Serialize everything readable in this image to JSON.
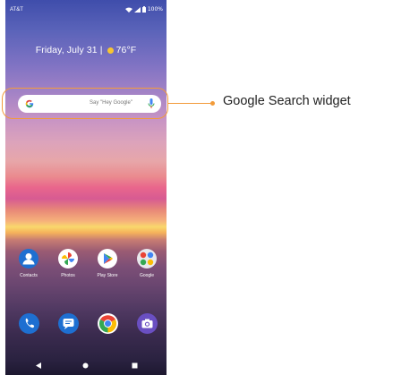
{
  "status_bar": {
    "carrier": "AT&T",
    "battery": "100%"
  },
  "home": {
    "date": "Friday, July 31",
    "separator": "|",
    "weather": "76°F"
  },
  "search_widget": {
    "hint": "Say \"Hey Google\""
  },
  "apps": [
    {
      "label": "Contacts",
      "icon": "contacts-icon"
    },
    {
      "label": "Photos",
      "icon": "photos-icon"
    },
    {
      "label": "Play Store",
      "icon": "play-store-icon"
    },
    {
      "label": "Google",
      "icon": "google-folder-icon"
    }
  ],
  "dock": [
    {
      "icon": "phone-icon"
    },
    {
      "icon": "messages-icon"
    },
    {
      "icon": "chrome-icon"
    },
    {
      "icon": "camera-icon"
    }
  ],
  "callout": {
    "label": "Google Search widget",
    "color": "#f29b3a"
  }
}
